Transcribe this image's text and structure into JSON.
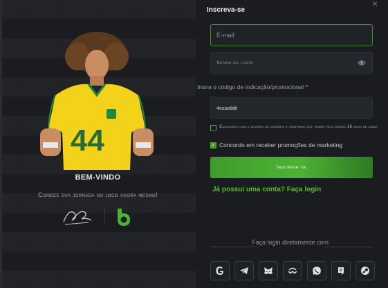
{
  "welcome": {
    "title": "BEM-VINDO",
    "subtitle": "Comece sua jornada no jogo agora mesmo!",
    "player_number": "44"
  },
  "form": {
    "title": "Inscreva-se",
    "email_placeholder": "E-mail",
    "password_placeholder": "Senha de login",
    "promo_label": "Insira o código de indicação/promocional ^",
    "promo_value": "4cxse8dr",
    "terms_text": "Concordo com o acordo do usuário e confirmo que tenho pelo menos 18 anos de idade",
    "terms_checked": false,
    "marketing_text": "Concordo em receber promoções de marketing",
    "marketing_checked": true,
    "signup_label": "Inscreva-se",
    "login_link": "Já possui uma conta? Faça login",
    "social_divider": "Faça login diretamente com"
  },
  "social_icons": [
    "google-icon",
    "telegram-icon",
    "metamask-icon",
    "wallet-connect-icon",
    "whatsapp-icon",
    "line-icon",
    "steam-icon"
  ],
  "colors": {
    "accent_green": "#4bb333",
    "background": "#1a1c1f",
    "jersey_yellow": "#f2d21b"
  }
}
